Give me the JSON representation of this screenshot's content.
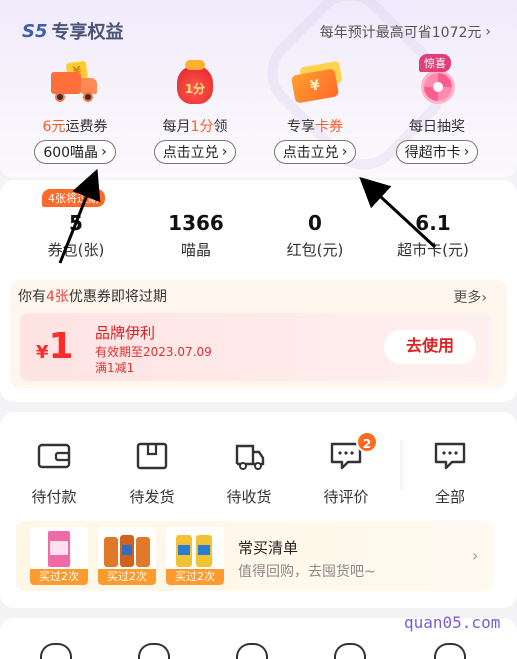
{
  "header": {
    "brand_badge": "S5",
    "brand_title": "专享权益",
    "save_text": "每年预计最高可省1072元",
    "save_chevron": "›"
  },
  "benefits": [
    {
      "label_pre": "",
      "label_hl": "6元",
      "label_post": "运费券",
      "button": "600喵晶",
      "icon": "truck-icon"
    },
    {
      "label_pre": "每月",
      "label_hl": "1分",
      "label_post": "领",
      "button": "点击立兑",
      "icon": "lucky-bag-icon"
    },
    {
      "label_pre": "专享",
      "label_hl": "卡券",
      "label_post": "",
      "button": "点击立兑",
      "icon": "ticket-icon"
    },
    {
      "label_pre": "每日抽奖",
      "label_hl": "",
      "label_post": "",
      "button": "得超市卡",
      "icon": "lottery-wheel-icon",
      "badge": "惊喜"
    }
  ],
  "benefit_icon_text": {
    "coin": "¥",
    "bag": "1分",
    "ticket": "¥"
  },
  "stats": {
    "badge": "4张将过期",
    "items": [
      {
        "value": "5",
        "label": "券包(张)"
      },
      {
        "value": "1366",
        "label": "喵晶"
      },
      {
        "value": "0",
        "label": "红包(元)"
      },
      {
        "value": "6.1",
        "label": "超市卡(元)"
      }
    ]
  },
  "coupon_notice": {
    "prefix": "你有",
    "count": "4张",
    "suffix": "优惠券即将过期",
    "more": "更多›"
  },
  "coupon": {
    "currency": "¥",
    "amount": "1",
    "name": "品牌伊利",
    "valid": "有效期至2023.07.09",
    "rule": "满1减1",
    "button": "去使用"
  },
  "orders": {
    "items": [
      {
        "label": "待付款",
        "icon": "wallet-icon"
      },
      {
        "label": "待发货",
        "icon": "package-icon"
      },
      {
        "label": "待收货",
        "icon": "delivery-truck-icon"
      },
      {
        "label": "待评价",
        "icon": "comment-icon",
        "badge": "2"
      },
      {
        "label": "全部",
        "icon": "all-orders-icon"
      }
    ]
  },
  "frequent": {
    "tags": [
      "买过2次",
      "买过2次",
      "买过2次"
    ],
    "title": "常买清单",
    "subtitle": "值得回购，去囤货吧~",
    "chevron": "›"
  },
  "watermark": "quan05.com",
  "colors": {
    "accent_orange": "#ff6a2b",
    "accent_red": "#e02020",
    "brand_blue": "#3f5fa8"
  }
}
